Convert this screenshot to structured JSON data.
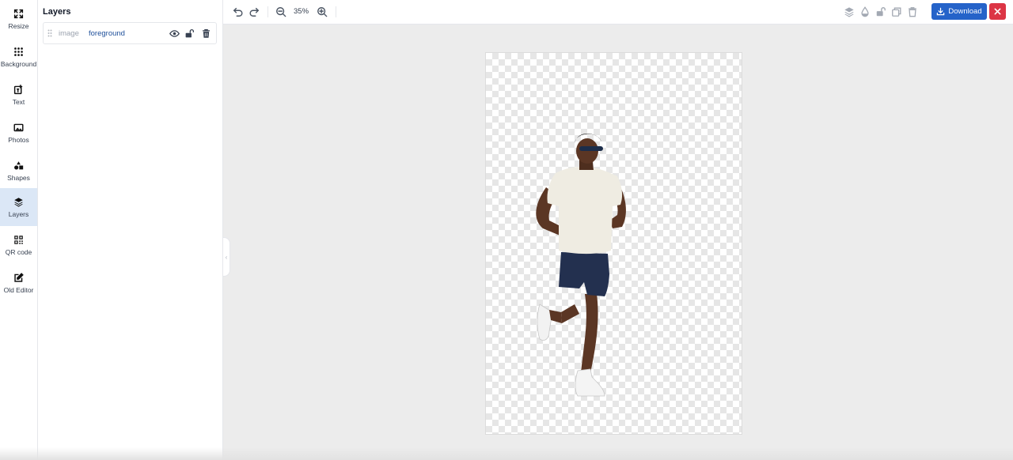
{
  "rail": {
    "items": [
      {
        "label": "Resize",
        "icon": "resize-icon"
      },
      {
        "label": "Background",
        "icon": "dots-grid-icon"
      },
      {
        "label": "Text",
        "icon": "text-icon"
      },
      {
        "label": "Photos",
        "icon": "photo-icon"
      },
      {
        "label": "Shapes",
        "icon": "shapes-icon"
      },
      {
        "label": "Layers",
        "icon": "layers-icon",
        "active": true
      },
      {
        "label": "QR code",
        "icon": "qr-code-icon"
      },
      {
        "label": "Old Editor",
        "icon": "edit-icon"
      }
    ]
  },
  "panel": {
    "title": "Layers",
    "layers": [
      {
        "type": "image",
        "name": "foreground"
      }
    ]
  },
  "toolbar": {
    "zoom": "35%",
    "download_label": "Download"
  },
  "colors": {
    "accent": "#2563c9",
    "danger": "#dc3545",
    "active_rail": "#dbe7f6",
    "layer_name": "#1e4f9a"
  }
}
